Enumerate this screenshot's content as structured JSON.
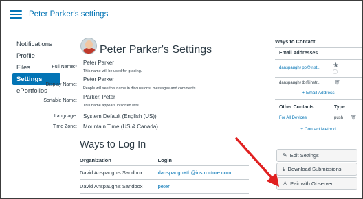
{
  "header": {
    "title": "Peter Parker's settings"
  },
  "nav": {
    "items": [
      "Notifications",
      "Profile",
      "Files",
      "Settings",
      "ePortfolios"
    ],
    "active": "Settings"
  },
  "profile": {
    "title": "Peter Parker's Settings",
    "full_name": {
      "label": "Full Name:*",
      "value": "Peter Parker",
      "help": "This name will be used for grading."
    },
    "display_name": {
      "label": "Display Name:",
      "value": "Peter Parker",
      "help": "People will see this name in discussions, messages and comments."
    },
    "sortable_name": {
      "label": "Sortable Name:",
      "value": "Parker, Peter",
      "help": "This name appears in sorted lists."
    },
    "language": {
      "label": "Language:",
      "value": "System Default (English (US))"
    },
    "time_zone": {
      "label": "Time Zone:",
      "value": "Mountain Time (US & Canada)"
    }
  },
  "logins": {
    "title": "Ways to Log In",
    "columns": [
      "Organization",
      "Login"
    ],
    "rows": [
      {
        "organization": "David Anspaugh's Sandbox",
        "login": "danspaugh+tb@instructure.com"
      },
      {
        "organization": "David Anspaugh's Sandbox",
        "login": "peter"
      }
    ]
  },
  "contact": {
    "title": "Ways to Contact",
    "email_header": "Email Addresses",
    "emails": [
      "danspaugh+pp@inst...",
      "danspaugh+tb@instr..."
    ],
    "add_email": "+ Email Address",
    "other_header": "Other Contacts",
    "type_header": "Type",
    "other": [
      {
        "name": "For All Devices",
        "type": "push"
      }
    ],
    "add_contact": "+ Contact Method"
  },
  "actions": {
    "edit": "Edit Settings",
    "download": "Download Submissions",
    "pair": "Pair with Observer"
  },
  "colors": {
    "accent": "#0374b5",
    "arrow": "#e02020",
    "text": "#2d3b45"
  }
}
